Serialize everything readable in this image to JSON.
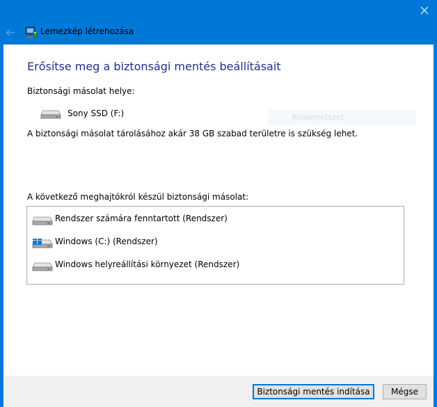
{
  "window": {
    "back_icon": "back-arrow-icon",
    "close_icon": "close-icon",
    "app_icon": "backup-computer-icon",
    "app_title": "Lemezkép létrehozása"
  },
  "content": {
    "heading": "Erősítse meg a biztonsági mentés beállításait",
    "location_label": "Biztonsági másolat helye:",
    "location": {
      "icon": "drive-icon",
      "name": "Sony SSD (F:)"
    },
    "ghost_text": "Ablakmetszet",
    "space_note": "A biztonsági másolat tárolásához akár 38 GB szabad területre is szükség lehet.",
    "drives_label": "A következő meghajtókról készül biztonsági másolat:",
    "drives": [
      {
        "icon": "drive-icon",
        "label": "Rendszer számára fenntartott (Rendszer)"
      },
      {
        "icon": "windows-drive-icon",
        "label": "Windows (C:) (Rendszer)"
      },
      {
        "icon": "drive-icon",
        "label": "Windows helyreállítási környezet (Rendszer)"
      }
    ]
  },
  "footer": {
    "start_label": "Biztonsági mentés indítása",
    "cancel_label": "Mégse"
  },
  "colors": {
    "accent": "#0078d7",
    "heading": "#1e3287",
    "footer_bg": "#f0f0f0",
    "button_bg": "#e1e1e1"
  }
}
